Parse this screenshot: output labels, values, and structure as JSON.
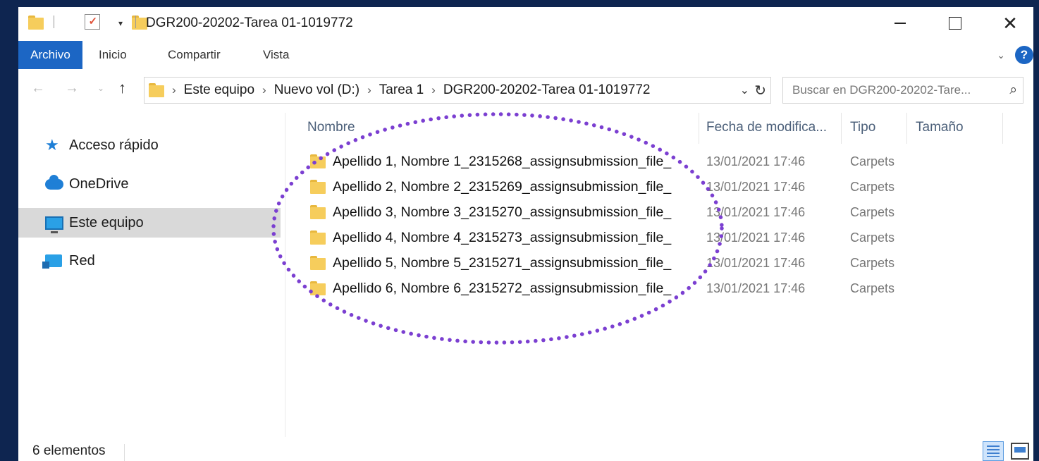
{
  "window": {
    "title": "DGR200-20202-Tarea 01-1019772",
    "controls": {
      "minimize": "minimize-icon",
      "maximize": "maximize-icon",
      "close": "✕"
    }
  },
  "ribbon": {
    "tabs": [
      {
        "label": "Archivo"
      },
      {
        "label": "Inicio"
      },
      {
        "label": "Compartir"
      },
      {
        "label": "Vista"
      }
    ],
    "help_label": "?"
  },
  "address": {
    "breadcrumbs": [
      "Este equipo",
      "Nuevo vol (D:)",
      "Tarea 1",
      "DGR200-20202-Tarea 01-1019772"
    ],
    "search_placeholder": "Buscar en DGR200-20202-Tare..."
  },
  "sidebar": {
    "items": [
      {
        "label": "Acceso rápido",
        "icon": "star-icon"
      },
      {
        "label": "OneDrive",
        "icon": "cloud-icon"
      },
      {
        "label": "Este equipo",
        "icon": "computer-icon",
        "selected": true
      },
      {
        "label": "Red",
        "icon": "network-icon"
      }
    ]
  },
  "file_list": {
    "columns": [
      "Nombre",
      "Fecha de modifica...",
      "Tipo",
      "Tamaño"
    ],
    "rows": [
      {
        "name": "Apellido 1, Nombre 1_2315268_assignsubmission_file_",
        "date": "13/01/2021 17:46",
        "type": "Carpets"
      },
      {
        "name": "Apellido 2, Nombre 2_2315269_assignsubmission_file_",
        "date": "13/01/2021 17:46",
        "type": "Carpets"
      },
      {
        "name": "Apellido 3, Nombre 3_2315270_assignsubmission_file_",
        "date": "13/01/2021 17:46",
        "type": "Carpets"
      },
      {
        "name": "Apellido 4, Nombre 4_2315273_assignsubmission_file_",
        "date": "13/01/2021 17:46",
        "type": "Carpets"
      },
      {
        "name": "Apellido 5, Nombre 5_2315271_assignsubmission_file_",
        "date": "13/01/2021 17:46",
        "type": "Carpets"
      },
      {
        "name": "Apellido 6, Nombre 6_2315272_assignsubmission_file_",
        "date": "13/01/2021 17:46",
        "type": "Carpets"
      }
    ]
  },
  "status": {
    "count_text": "6 elementos"
  },
  "colors": {
    "accent": "#1c66c4",
    "annotation": "#7b3fd1",
    "folder": "#f6cd5c",
    "outer_background": "#0e2550"
  }
}
